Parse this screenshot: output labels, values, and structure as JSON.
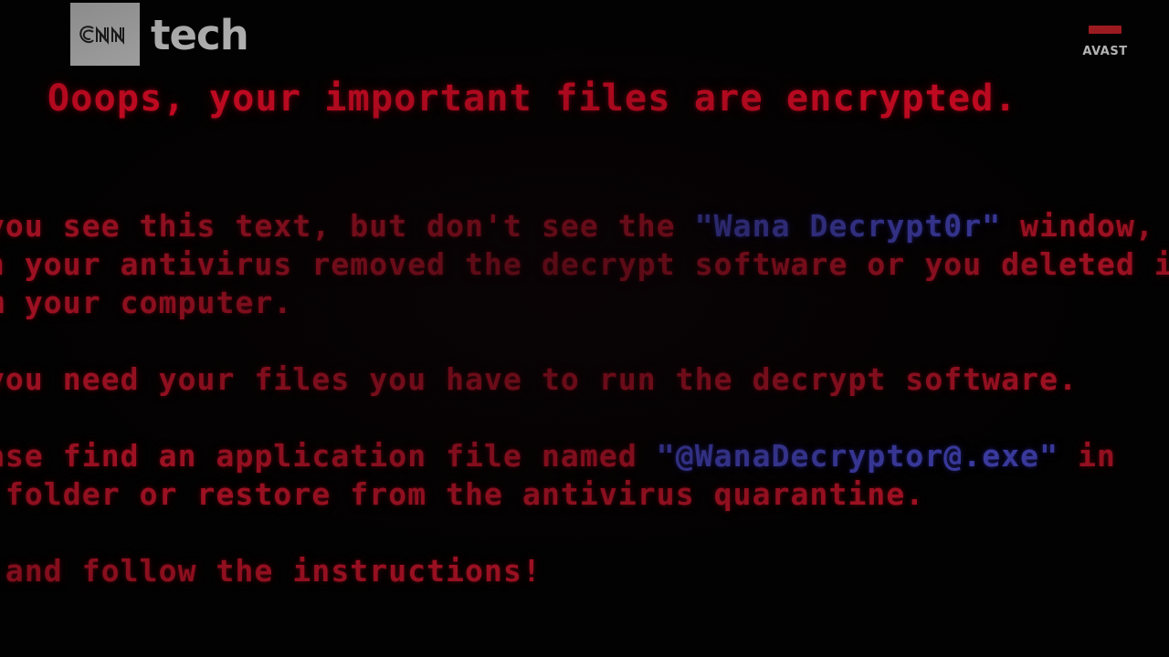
{
  "overlay": {
    "cnn": {
      "logo_text": "CNN",
      "word": "tech",
      "box_color": "#a9a9a9",
      "word_color": "#b9b9b9"
    },
    "avast": {
      "word": "Avast",
      "mark_color": "#bb2026",
      "word_color": "#d2d2d2"
    }
  },
  "ransom_note": {
    "background_color": "#030202",
    "text_color": "#9d1122",
    "headline_color": "#c10a21",
    "highlight_color": "#3a3a9e",
    "headline": "Ooops, your important files are encrypted.",
    "paragraphs": [
      {
        "lines": [
          [
            {
              "text": "If you see this text, but don't see the ",
              "style": "normal"
            },
            {
              "text": "\"Wana Decrypt0r\"",
              "style": "highlight"
            },
            {
              "text": " window,",
              "style": "normal"
            }
          ],
          [
            {
              "text": "then your antivirus removed the decrypt software or you deleted it",
              "style": "normal"
            }
          ],
          [
            {
              "text": "from your computer.",
              "style": "normal"
            }
          ]
        ]
      },
      {
        "lines": [
          [
            {
              "text": "If you need your files you have to run the decrypt software.",
              "style": "normal"
            }
          ]
        ]
      },
      {
        "lines": [
          [
            {
              "text": "Please find an application file named ",
              "style": "normal"
            },
            {
              "text": "\"@WanaDecryptor@.exe\"",
              "style": "highlight"
            },
            {
              "text": " in",
              "style": "normal"
            }
          ],
          [
            {
              "text": "any folder or restore from the antivirus quarantine.",
              "style": "normal"
            }
          ]
        ]
      },
      {
        "lines": [
          [
            {
              "text": "Run and follow the instructions!",
              "style": "normal"
            }
          ]
        ]
      }
    ]
  }
}
